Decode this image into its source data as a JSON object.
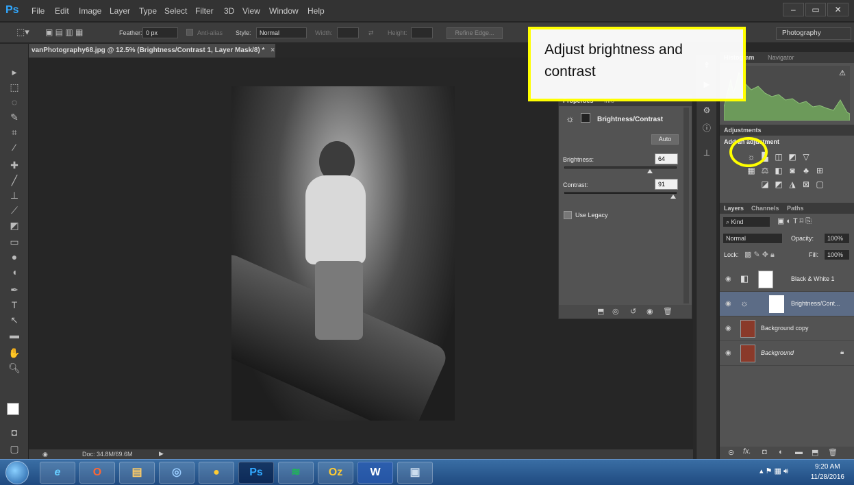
{
  "app": {
    "logo": "Ps",
    "menu": [
      "File",
      "Edit",
      "Image",
      "Layer",
      "Type",
      "Select",
      "Filter",
      "3D",
      "View",
      "Window",
      "Help"
    ],
    "window_controls": [
      "–",
      "▭",
      "✕"
    ]
  },
  "options_bar": {
    "feather_label": "Feather:",
    "feather_value": "0 px",
    "antialias_label": "Anti-alias",
    "style_label": "Style:",
    "style_value": "Normal",
    "width_label": "Width:",
    "height_label": "Height:",
    "refine_edge": "Refine Edge...",
    "workspace": "Photography"
  },
  "document": {
    "tab_title": "vanPhotography68.jpg @ 12.5% (Brightness/Contrast 1, Layer Mask/8) *",
    "status": "Doc: 34.8M/69.6M"
  },
  "properties": {
    "tabs": [
      "Properties",
      "Info"
    ],
    "title": "Brightness/Contrast",
    "auto": "Auto",
    "brightness_label": "Brightness:",
    "brightness_value": "64",
    "brightness_fraction": 0.76,
    "contrast_label": "Contrast:",
    "contrast_value": "91",
    "contrast_fraction": 0.97,
    "legacy_label": "Use Legacy"
  },
  "panels": {
    "histogram_tabs": [
      "Histogram",
      "Navigator"
    ],
    "adjustments_tab": "Adjustments",
    "add_adjustment": "Add an adjustment",
    "layers_tabs": [
      "Layers",
      "Channels",
      "Paths"
    ],
    "kind": "Kind",
    "blend_mode": "Normal",
    "opacity_label": "Opacity:",
    "opacity_value": "100%",
    "lock_label": "Lock:",
    "fill_label": "Fill:",
    "fill_value": "100%",
    "layers": [
      {
        "name": "Black & White 1"
      },
      {
        "name": "Brightness/Cont..."
      },
      {
        "name": "Background copy"
      },
      {
        "name": "Background"
      }
    ]
  },
  "annotation": {
    "text": "Adjust brightness and contrast",
    "color": "#ffff00"
  },
  "taskbar": {
    "apps": [
      "e",
      "O",
      "▤",
      "◎",
      "●",
      "Ps",
      "≋",
      "Oz",
      "W",
      "▣"
    ],
    "time": "9:20 AM",
    "date": "11/28/2016"
  }
}
